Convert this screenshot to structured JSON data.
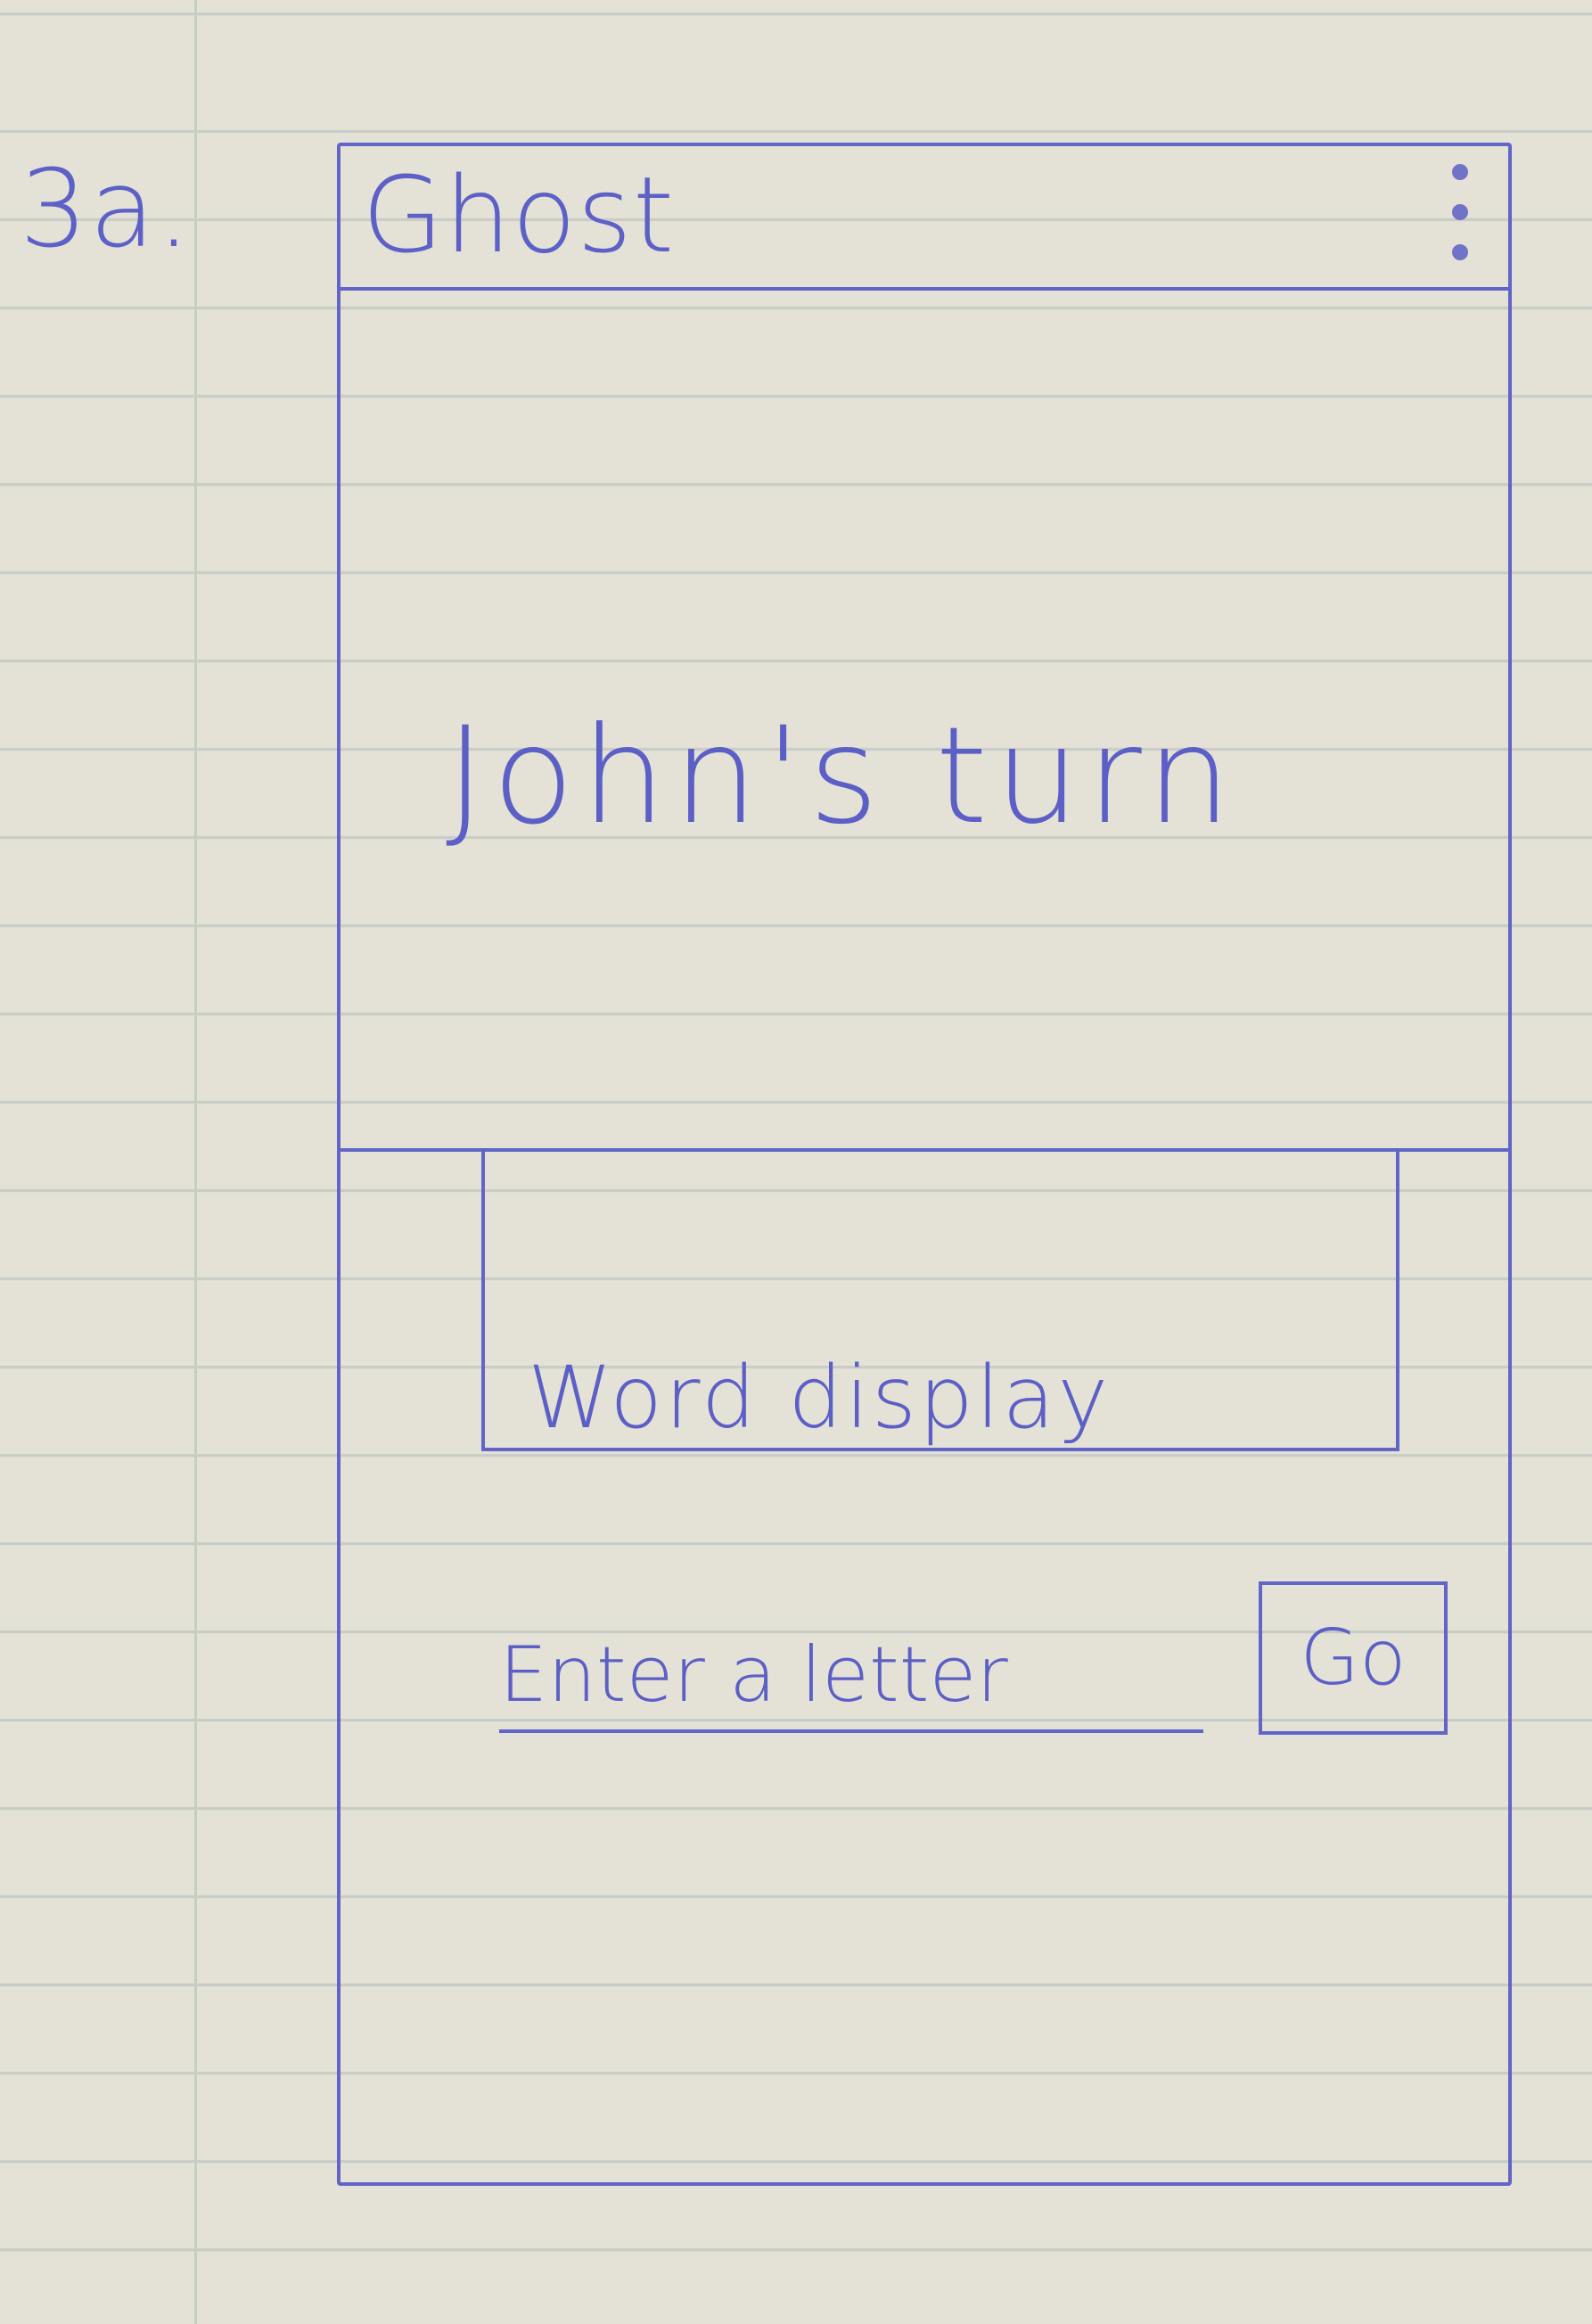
{
  "sketch": {
    "label": "3a."
  },
  "app_bar": {
    "title": "Ghost",
    "menu_icon": "overflow-menu-icon"
  },
  "game": {
    "turn_text": "John's turn",
    "word_display": "Word display"
  },
  "input": {
    "placeholder": "Enter a letter",
    "value": ""
  },
  "go_button": {
    "label": "Go"
  },
  "colors": {
    "ink": "#5c5fc5",
    "paper": "#e4e2d6"
  }
}
